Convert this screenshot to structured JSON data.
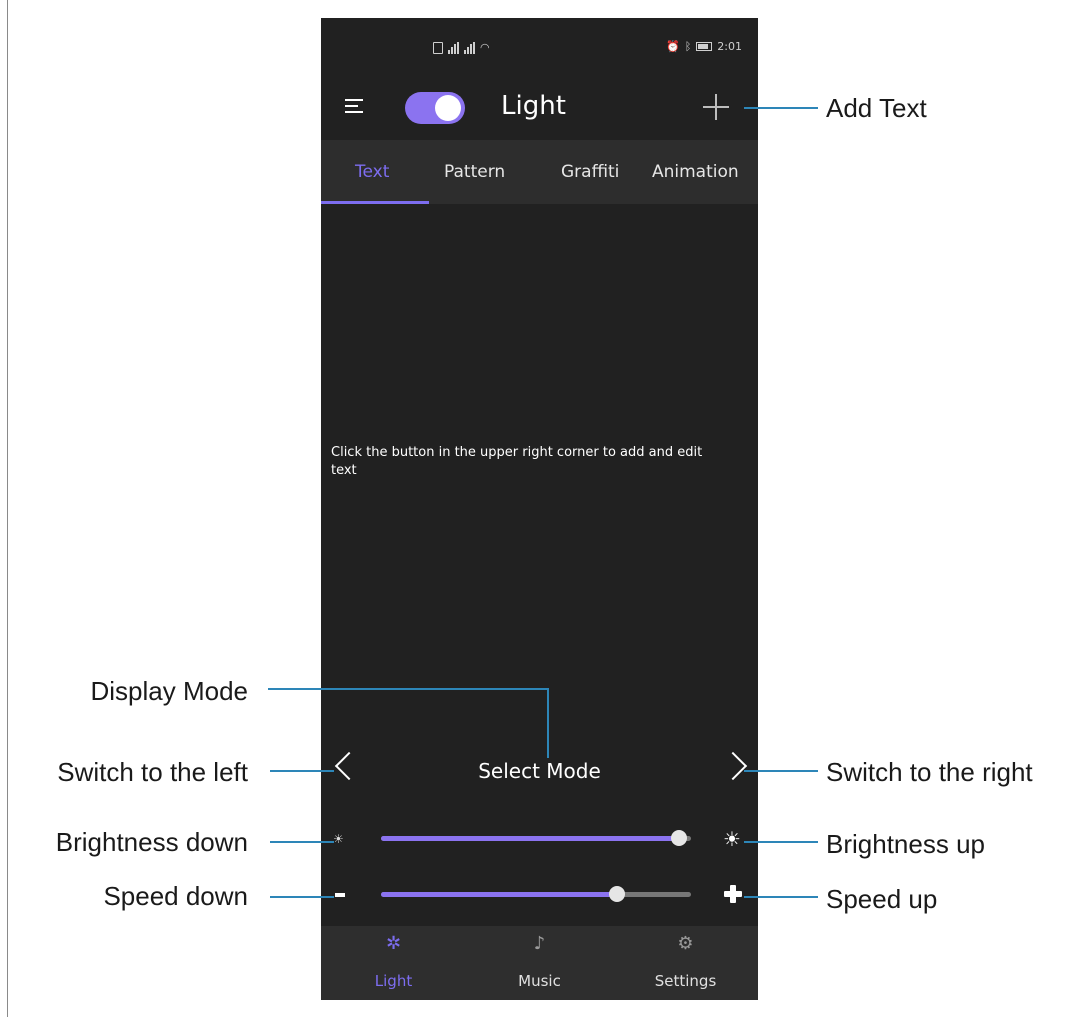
{
  "status_bar": {
    "time": "2:01"
  },
  "app_bar": {
    "title": "Light",
    "power_on": true
  },
  "tabs": [
    {
      "label": "Text",
      "active": true
    },
    {
      "label": "Pattern",
      "active": false
    },
    {
      "label": "Graffiti",
      "active": false
    },
    {
      "label": "Animation",
      "active": false
    }
  ],
  "content": {
    "hint_text": "Click the button in the upper right corner to add and edit text"
  },
  "controls": {
    "mode_label": "Select Mode",
    "brightness_value": 0.96,
    "speed_value": 0.76
  },
  "bottom_nav": [
    {
      "label": "Light",
      "icon": "light-icon",
      "active": true
    },
    {
      "label": "Music",
      "icon": "music-icon",
      "active": false
    },
    {
      "label": "Settings",
      "icon": "settings-icon",
      "active": false
    }
  ],
  "annotations": {
    "add_text": "Add Text",
    "display_mode": "Display Mode",
    "switch_left": "Switch to the left",
    "switch_right": "Switch to the right",
    "brightness_down": "Brightness down",
    "brightness_up": "Brightness up",
    "speed_down": "Speed down",
    "speed_up": "Speed up"
  },
  "colors": {
    "accent": "#7d6df0",
    "background": "#212121",
    "callout_line": "#2d86b8"
  }
}
